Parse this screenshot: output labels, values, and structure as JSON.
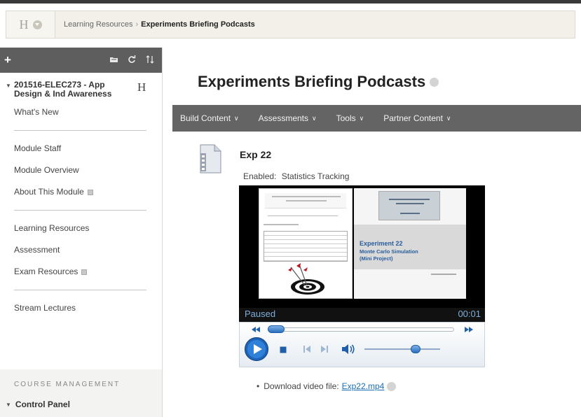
{
  "header": {
    "home_letter": "H",
    "breadcrumb": {
      "parent": "Learning Resources",
      "separator": "›",
      "current": "Experiments Briefing Podcasts"
    }
  },
  "sidebar": {
    "tools": {
      "add": "+",
      "icons": [
        "folder-icon",
        "refresh-icon",
        "sort-icon"
      ]
    },
    "course_title": "201516-ELEC273 - App Design & Ind Awareness",
    "course_home_letter": "H",
    "groups": [
      [
        {
          "label": "What's New",
          "flag": false
        }
      ],
      [
        {
          "label": "Module Staff",
          "flag": false
        },
        {
          "label": "Module Overview",
          "flag": false
        },
        {
          "label": "About This Module",
          "flag": true
        }
      ],
      [
        {
          "label": "Learning Resources",
          "flag": false
        },
        {
          "label": "Assessment",
          "flag": false
        },
        {
          "label": "Exam Resources",
          "flag": true
        }
      ],
      [
        {
          "label": "Stream Lectures",
          "flag": false
        }
      ]
    ],
    "course_management_label": "COURSE MANAGEMENT",
    "control_panel": "Control Panel"
  },
  "main": {
    "title": "Experiments Briefing Podcasts",
    "actions": [
      {
        "label": "Build Content"
      },
      {
        "label": "Assessments"
      },
      {
        "label": "Tools"
      },
      {
        "label": "Partner Content"
      }
    ],
    "item": {
      "title": "Exp 22",
      "enabled_label": "Enabled:",
      "enabled_value": "Statistics Tracking",
      "slide_text": {
        "title": "Experiment 22",
        "line1": "Monte Carlo Simulation",
        "line2": "(Mini Project)"
      },
      "player": {
        "status": "Paused",
        "time": "00:01",
        "seek_progress": 0.0,
        "volume_level": 0.7
      },
      "download": {
        "prefix": "Download video file:",
        "link": "Exp22.mp4"
      }
    }
  },
  "colors": {
    "action_bar": "#646464",
    "link": "#1a6fb5",
    "player_status": "#7eaedb"
  }
}
